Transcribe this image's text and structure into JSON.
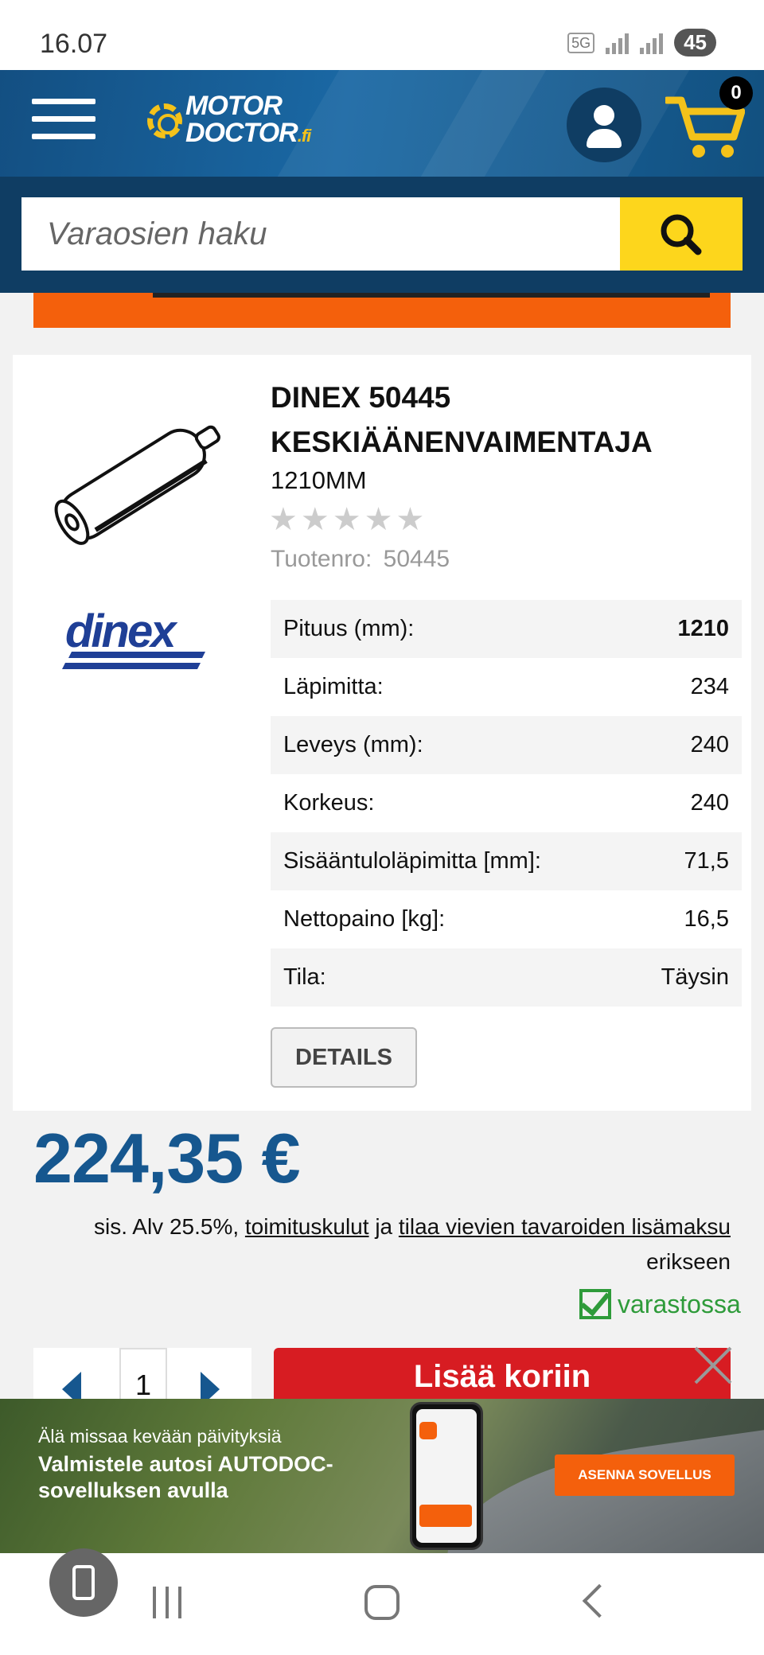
{
  "status_bar": {
    "time": "16.07",
    "network": "5G",
    "battery": "45"
  },
  "header": {
    "logo_line1": "MOTOR",
    "logo_line2": "DOCTOR",
    "logo_suffix": ".fi",
    "cart_count": "0"
  },
  "search": {
    "placeholder": "Varaosien haku"
  },
  "product": {
    "title": "DINEX 50445 KESKIÄÄNENVAIMENTAJA",
    "subtitle": "1210MM",
    "rating": 0,
    "rating_max": 5,
    "number_label": "Tuotenro:",
    "number": "50445",
    "brand": "DINEX",
    "specs": [
      {
        "label": "Pituus (mm):",
        "value": "1210"
      },
      {
        "label": "Läpimitta:",
        "value": "234"
      },
      {
        "label": "Leveys (mm):",
        "value": "240"
      },
      {
        "label": "Korkeus:",
        "value": "240"
      },
      {
        "label": "Sisääntuloläpimitta [mm]:",
        "value": "71,5"
      },
      {
        "label": "Nettopaino [kg]:",
        "value": "16,5"
      },
      {
        "label": "Tila:",
        "value": "Täysin"
      }
    ],
    "details_label": "DETAILS"
  },
  "pricing": {
    "price": "224,35 €",
    "tax_prefix": "sis. Alv 25.5%,",
    "shipping_link": "toimituskulut",
    "tax_and": "ja",
    "extra_fee_link": "tilaa vievien tavaroiden lisämaksu",
    "tax_suffix": "erikseen",
    "stock_status": "varastossa"
  },
  "cart": {
    "quantity": "1",
    "add_label": "Lisää koriin"
  },
  "ad": {
    "line1": "Älä missaa kevään päivityksiä",
    "line2": "Valmistele autosi AUTODOC-sovelluksen avulla",
    "button": "ASENNA SOVELLUS"
  },
  "colors": {
    "brand_blue": "#16578f",
    "header_dark": "#0f3d63",
    "accent_yellow": "#fdd61c",
    "orange": "#f4600c",
    "cart_red": "#d71c22",
    "stock_green": "#2e9b3a"
  }
}
